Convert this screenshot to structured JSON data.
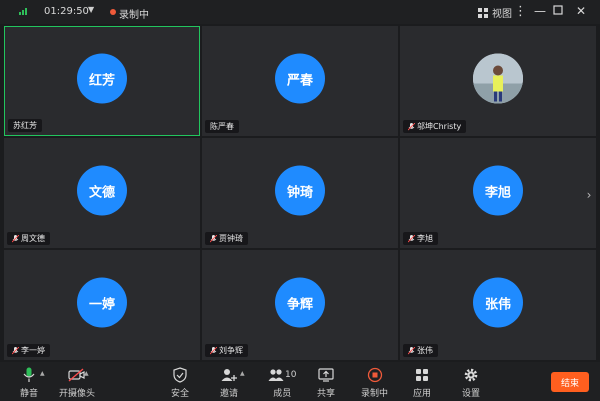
{
  "titlebar": {
    "time": "01:29:50",
    "recording_label": "录制中",
    "view_label": "视图"
  },
  "participants": [
    {
      "avatar_text": "红芳",
      "name": "苏红芳",
      "active": true,
      "muted": false
    },
    {
      "avatar_text": "严春",
      "name": "陈严春",
      "active": false,
      "muted": false
    },
    {
      "avatar_text": "",
      "name": "邬坤Christy",
      "active": false,
      "muted": true,
      "photo": true
    },
    {
      "avatar_text": "文德",
      "name": "周文德",
      "active": false,
      "muted": true
    },
    {
      "avatar_text": "钟琦",
      "name": "贾钟琦",
      "active": false,
      "muted": true
    },
    {
      "avatar_text": "李旭",
      "name": "李旭",
      "active": false,
      "muted": true
    },
    {
      "avatar_text": "一婷",
      "name": "李一婷",
      "active": false,
      "muted": true
    },
    {
      "avatar_text": "争辉",
      "name": "刘争辉",
      "active": false,
      "muted": true
    },
    {
      "avatar_text": "张伟",
      "name": "张伟",
      "active": false,
      "muted": true
    }
  ],
  "toolbar": {
    "mute_label": "静音",
    "camera_label": "开摄像头",
    "security_label": "安全",
    "invite_label": "邀请",
    "members_label": "成员",
    "members_count": "10",
    "share_label": "共享",
    "recording_label": "录制中",
    "apps_label": "应用",
    "settings_label": "设置",
    "end_label": "结束"
  },
  "colors": {
    "avatar_blue": "#1f8bff",
    "active_border": "#22c55e",
    "end_button": "#ff5f1f",
    "record_red": "#f05a3a"
  }
}
